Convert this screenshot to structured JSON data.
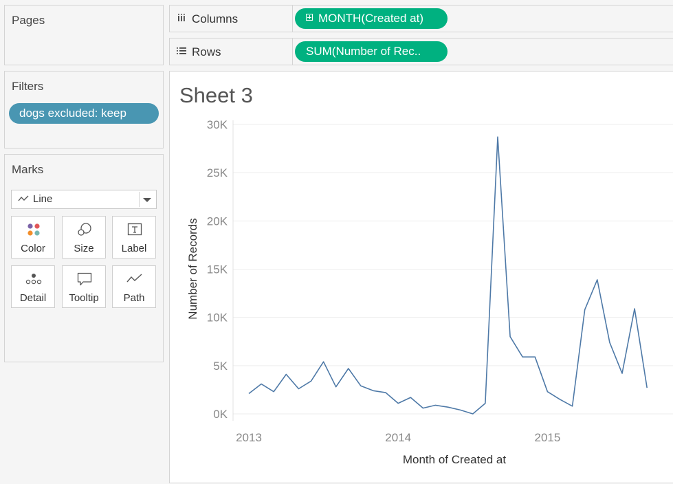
{
  "pages": {
    "title": "Pages"
  },
  "filters": {
    "title": "Filters",
    "items": [
      {
        "label": "dogs excluded: keep"
      }
    ]
  },
  "marks": {
    "title": "Marks",
    "mark_type": "Line",
    "buttons": [
      {
        "label": "Color",
        "icon": "color-dots-icon"
      },
      {
        "label": "Size",
        "icon": "size-circles-icon"
      },
      {
        "label": "Label",
        "icon": "text-label-icon"
      },
      {
        "label": "Detail",
        "icon": "detail-dots-icon"
      },
      {
        "label": "Tooltip",
        "icon": "tooltip-speech-icon"
      },
      {
        "label": "Path",
        "icon": "path-line-icon"
      }
    ]
  },
  "shelves": {
    "columns": {
      "label": "Columns",
      "pill": "MONTH(Created at)"
    },
    "rows": {
      "label": "Rows",
      "pill": "SUM(Number of Rec.."
    }
  },
  "sheet": {
    "title": "Sheet 3"
  },
  "colors": {
    "filter_pill": "#4996b2",
    "field_pill": "#00b180",
    "line": "#4e79a7",
    "color_dots": [
      "#7b63a8",
      "#e15759",
      "#f28e2b",
      "#76b7b2"
    ]
  },
  "chart_data": {
    "type": "line",
    "x": [
      "2013-01",
      "2013-02",
      "2013-03",
      "2013-04",
      "2013-05",
      "2013-06",
      "2013-07",
      "2013-08",
      "2013-09",
      "2013-10",
      "2013-11",
      "2013-12",
      "2014-01",
      "2014-02",
      "2014-03",
      "2014-04",
      "2014-05",
      "2014-06",
      "2014-07",
      "2014-08",
      "2014-09",
      "2014-10",
      "2014-11",
      "2014-12",
      "2015-01",
      "2015-02",
      "2015-03",
      "2015-04",
      "2015-05",
      "2015-06",
      "2015-07",
      "2015-08",
      "2015-09",
      "2015-10"
    ],
    "series": [
      {
        "values": [
          2100,
          3100,
          2300,
          4100,
          2600,
          3400,
          5400,
          2800,
          4700,
          2900,
          2400,
          2200,
          1100,
          1700,
          600,
          900,
          700,
          400,
          0,
          1100,
          28700,
          8000,
          5900,
          5900,
          2300,
          1500,
          800,
          10800,
          13900,
          7400,
          4200,
          10900,
          2700
        ]
      }
    ],
    "xlabel": "Month of Created at",
    "ylabel": "Number of Records",
    "yticks": [
      "0K",
      "5K",
      "10K",
      "15K",
      "20K",
      "25K",
      "30K"
    ],
    "ytick_values": [
      0,
      5000,
      10000,
      15000,
      20000,
      25000,
      30000
    ],
    "xticks": [
      "2013",
      "2014",
      "2015"
    ],
    "xtick_values": [
      "2013-01",
      "2014-01",
      "2015-01"
    ],
    "ylim": [
      0,
      30000
    ],
    "grid": true
  }
}
